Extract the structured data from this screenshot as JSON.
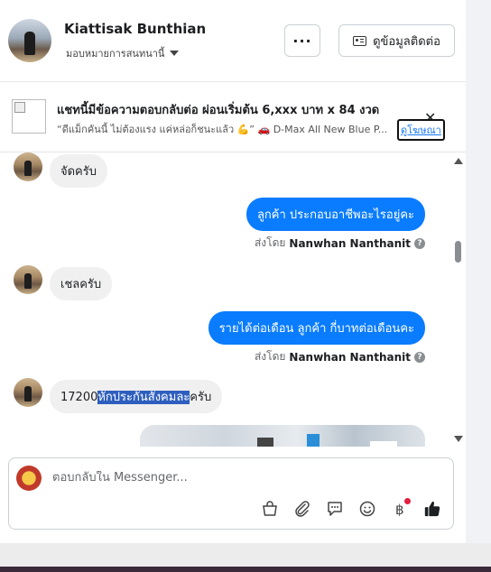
{
  "header": {
    "name": "Kiattisak Bunthian",
    "assign_label": "มอบหมายการสนทนานี้",
    "more_label": "···",
    "contact_label": "ดูข้อมูลติดต่อ"
  },
  "ad": {
    "title": "แชทนี้มีข้อความตอบกลับต่อ ผ่อนเริ่มต้น 6,xxx บาท x 84 งวด",
    "subtitle": "“ดีแม็กคันนี้ ไม่ต้องแรง แค่หล่อก็ชนะแล้ว 💪” 🚗 D-Max All New Blue P...",
    "close_label": "✕",
    "link_label": "ดูโฆษณา"
  },
  "messages": {
    "m1": "จัดครับ",
    "m2": "ลูกค้า ประกอบอาชีพอะไรอยู่คะ",
    "sent_prefix": "ส่งโดย",
    "sender": "Nanwhan Nanthanit",
    "m3": "เชลครับ",
    "m4": "รายได้ต่อเดือน ลูกค้า  กี่บาทต่อเดือนคะ",
    "m5_pre": "17200",
    "m5_hl": "หักประกันสังคมละ",
    "m5_post": "ครับ"
  },
  "composer": {
    "placeholder": "ตอบกลับใน Messenger..."
  },
  "colors": {
    "accent": "#0a7cff",
    "link": "#1877f2",
    "highlight": "#2e5fbf",
    "notify": "#e41e3f"
  },
  "icons": [
    "chevron-down-icon",
    "contact-card-icon",
    "close-icon",
    "scroll-up-icon",
    "scroll-down-icon",
    "info-icon",
    "shop-bag-icon",
    "paperclip-icon",
    "saved-replies-icon",
    "emoji-icon",
    "baht-icon",
    "like-icon"
  ]
}
